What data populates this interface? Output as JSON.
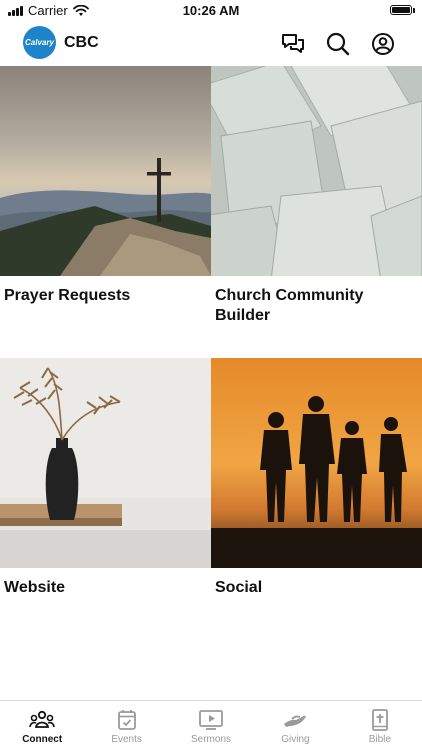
{
  "status_bar": {
    "carrier": "Carrier",
    "time": "10:26 AM"
  },
  "header": {
    "logo_text": "Calvary",
    "title": "CBC"
  },
  "tiles": [
    {
      "label": "Prayer Requests"
    },
    {
      "label": "Church Community Builder"
    },
    {
      "label": "Website"
    },
    {
      "label": "Social"
    }
  ],
  "tabs": [
    {
      "label": "Connect",
      "icon": "people-icon",
      "active": true
    },
    {
      "label": "Events",
      "icon": "calendar-icon",
      "active": false
    },
    {
      "label": "Sermons",
      "icon": "play-icon",
      "active": false
    },
    {
      "label": "Giving",
      "icon": "hand-icon",
      "active": false
    },
    {
      "label": "Bible",
      "icon": "bible-icon",
      "active": false
    }
  ],
  "colors": {
    "brand": "#1e84c9",
    "active_tab": "#111111",
    "inactive_tab": "#9a9a9a"
  }
}
